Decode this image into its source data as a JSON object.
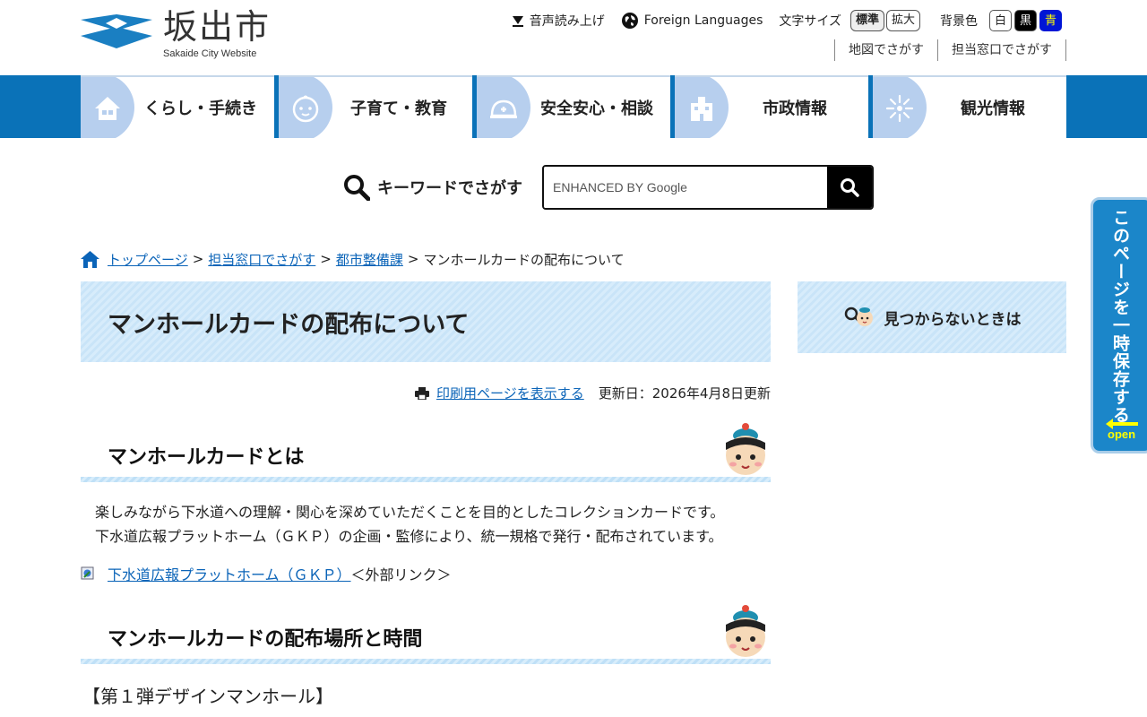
{
  "site": {
    "name": "坂出市",
    "sub": "Sakaide City Website"
  },
  "tools": {
    "speech": "音声読み上げ",
    "foreign": "Foreign Languages",
    "size_label": "文字サイズ",
    "size_standard": "標準",
    "size_large": "拡大",
    "bg_label": "背景色",
    "bg_white": "白",
    "bg_black": "黒",
    "bg_blue": "青"
  },
  "sublinks": {
    "map": "地図でさがす",
    "office": "担当窓口でさがす"
  },
  "nav": [
    {
      "label": "くらし・手続き",
      "icon": "house-icon"
    },
    {
      "label": "子育て・教育",
      "icon": "baby-icon"
    },
    {
      "label": "安全安心・相談",
      "icon": "helmet-icon"
    },
    {
      "label": "市政情報",
      "icon": "building-icon"
    },
    {
      "label": "観光情報",
      "icon": "firework-icon"
    }
  ],
  "search": {
    "label": "キーワードでさがす",
    "placeholder": "ENHANCED BY Google"
  },
  "breadcrumb": {
    "home": "トップページ",
    "office": "担当窓口でさがす",
    "dept": "都市整備課",
    "current": "マンホールカードの配布について",
    "sep": ">"
  },
  "main": {
    "title": "マンホールカードの配布について",
    "print": "印刷用ページを表示する",
    "updated": "更新日：2026年4月8日更新",
    "section1_title": "マンホールカードとは",
    "para1": "楽しみながら下水道への理解・関心を深めていただくことを目的としたコレクションカードです。",
    "para2": "下水道広報プラットホーム（ＧＫＰ）の企画・監修により、統一規格で発行・配布されています。",
    "ext_link": "下水道広報プラットホーム（ＧＫＰ）",
    "ext_note": "＜外部リンク＞",
    "section2_title": "マンホールカードの配布場所と時間",
    "subhead": "【第１弾デザインマンホール】"
  },
  "side": {
    "notfound": "見つからないときは"
  },
  "save_tab": {
    "text": "このページを一時保存する",
    "open": "open"
  },
  "colors": {
    "nav_bg": "#0a72b8",
    "nav_blob": "#b7cfee",
    "link": "#0b64b8",
    "tab_bg": "#1b86c9"
  }
}
